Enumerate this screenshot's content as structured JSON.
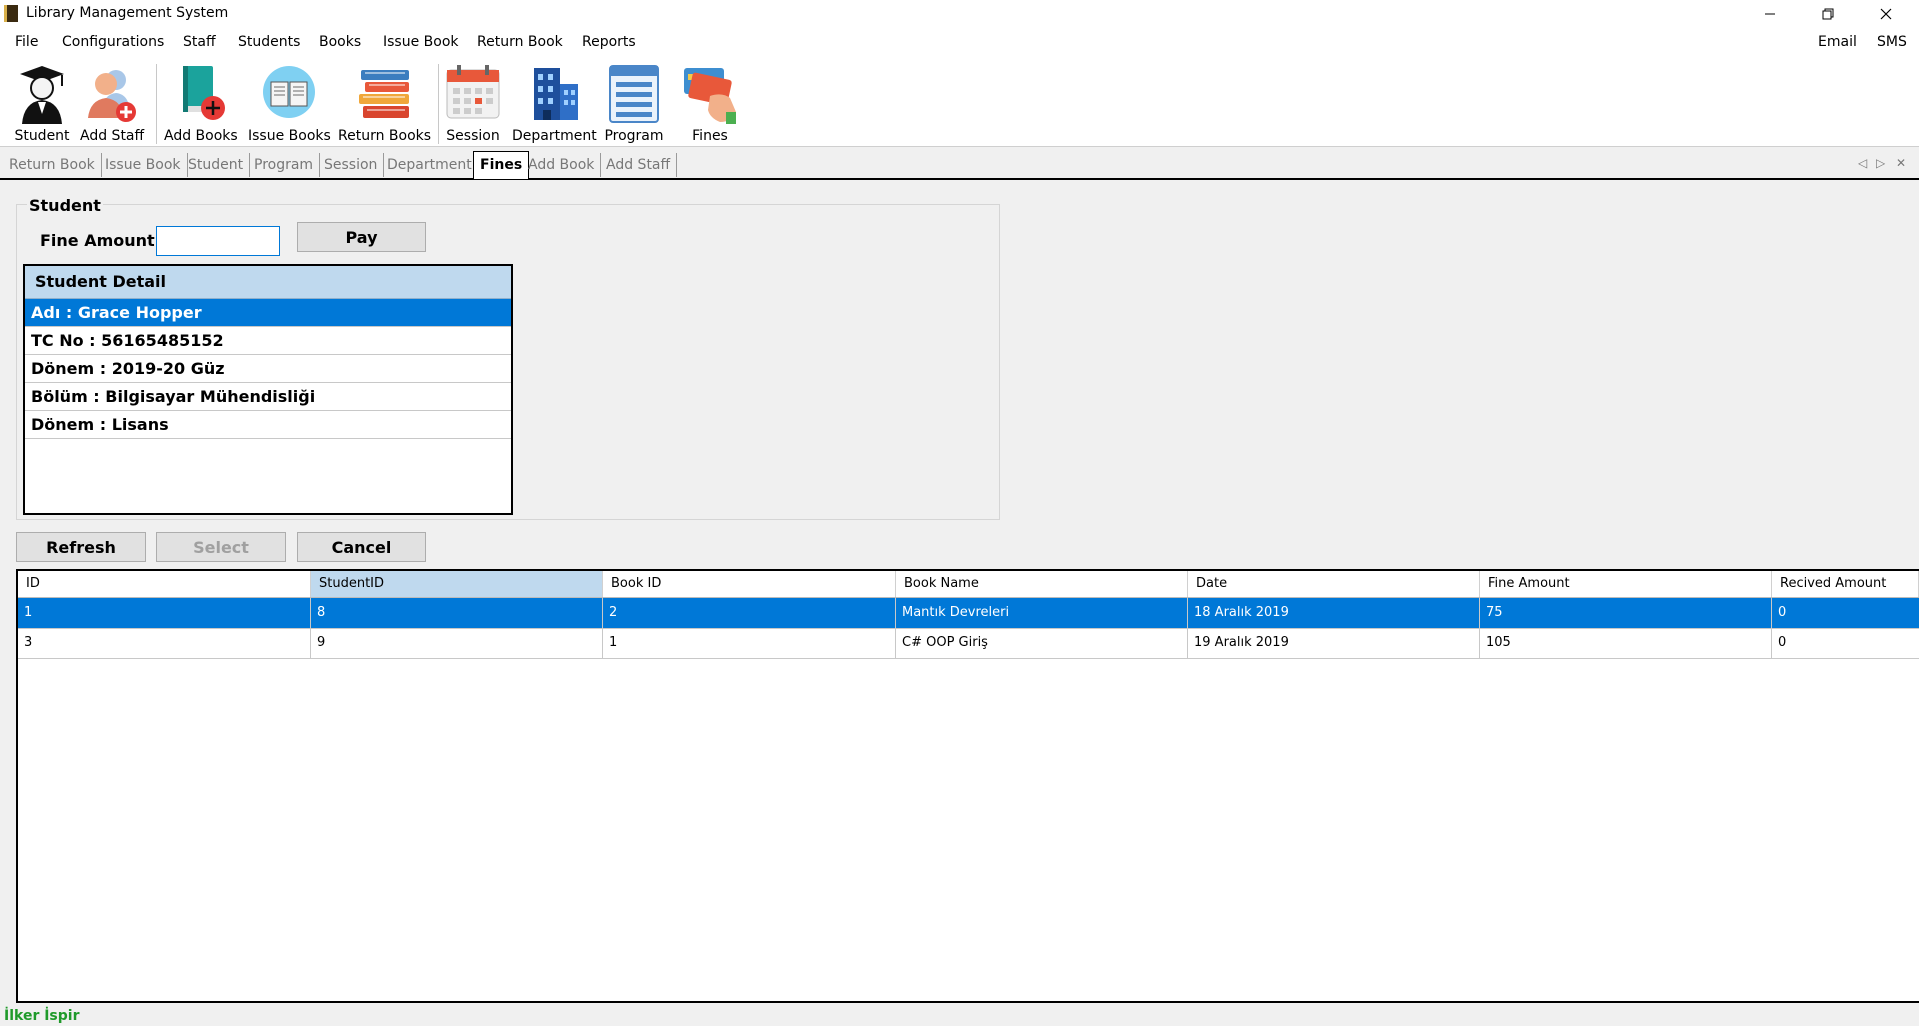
{
  "window": {
    "title": "Library Management System"
  },
  "menu": {
    "items": [
      "File",
      "Configurations",
      "Staff",
      "Students",
      "Books",
      "Issue Book",
      "Return Book",
      "Reports"
    ],
    "right_items": [
      "Email",
      "SMS"
    ]
  },
  "toolbar": {
    "buttons": [
      {
        "label": "Student",
        "icon": "student-graduate-icon"
      },
      {
        "label": "Add Staff",
        "icon": "add-staff-icon"
      },
      {
        "label": "Add Books",
        "icon": "add-book-icon"
      },
      {
        "label": "Issue Books",
        "icon": "issue-book-icon"
      },
      {
        "label": "Return Books",
        "icon": "book-stack-icon"
      },
      {
        "label": "Session",
        "icon": "calendar-icon"
      },
      {
        "label": "Department",
        "icon": "building-icon"
      },
      {
        "label": "Program",
        "icon": "program-list-icon"
      },
      {
        "label": "Fines",
        "icon": "credit-card-hand-icon"
      }
    ]
  },
  "tabs": {
    "items": [
      "Return Book",
      "Issue Book",
      "Student",
      "Program",
      "Session",
      "Department",
      "Fines",
      "Add Book",
      "Add Staff"
    ],
    "active": "Fines"
  },
  "student_group": {
    "title": "Student",
    "fine_amount_label": "Fine Amount",
    "fine_amount_value": "",
    "pay_button": "Pay"
  },
  "student_detail": {
    "header": "Student Detail",
    "rows": [
      "Adı   : Grace Hopper",
      "TC No : 56165485152",
      "Dönem : 2019-20 Güz",
      "Bölüm : Bilgisayar Mühendisliği",
      "Dönem : Lisans"
    ]
  },
  "actions": {
    "refresh": "Refresh",
    "select": "Select",
    "cancel": "Cancel"
  },
  "grid": {
    "columns": [
      "ID",
      "StudentID",
      "Book ID",
      "Book Name",
      "Date",
      "Fine Amount",
      "Recived Amount"
    ],
    "rows": [
      [
        "1",
        "8",
        "2",
        "Mantık Devreleri",
        "18 Aralık 2019",
        "75",
        "0"
      ],
      [
        "3",
        "9",
        "1",
        "C# OOP Giriş",
        "19 Aralık 2019",
        "105",
        "0"
      ]
    ]
  },
  "status": {
    "user": "İlker İspir"
  },
  "colors": {
    "selection": "#0078d7",
    "header_highlight": "#bfd9ee",
    "status_text": "#1f9a2a"
  }
}
